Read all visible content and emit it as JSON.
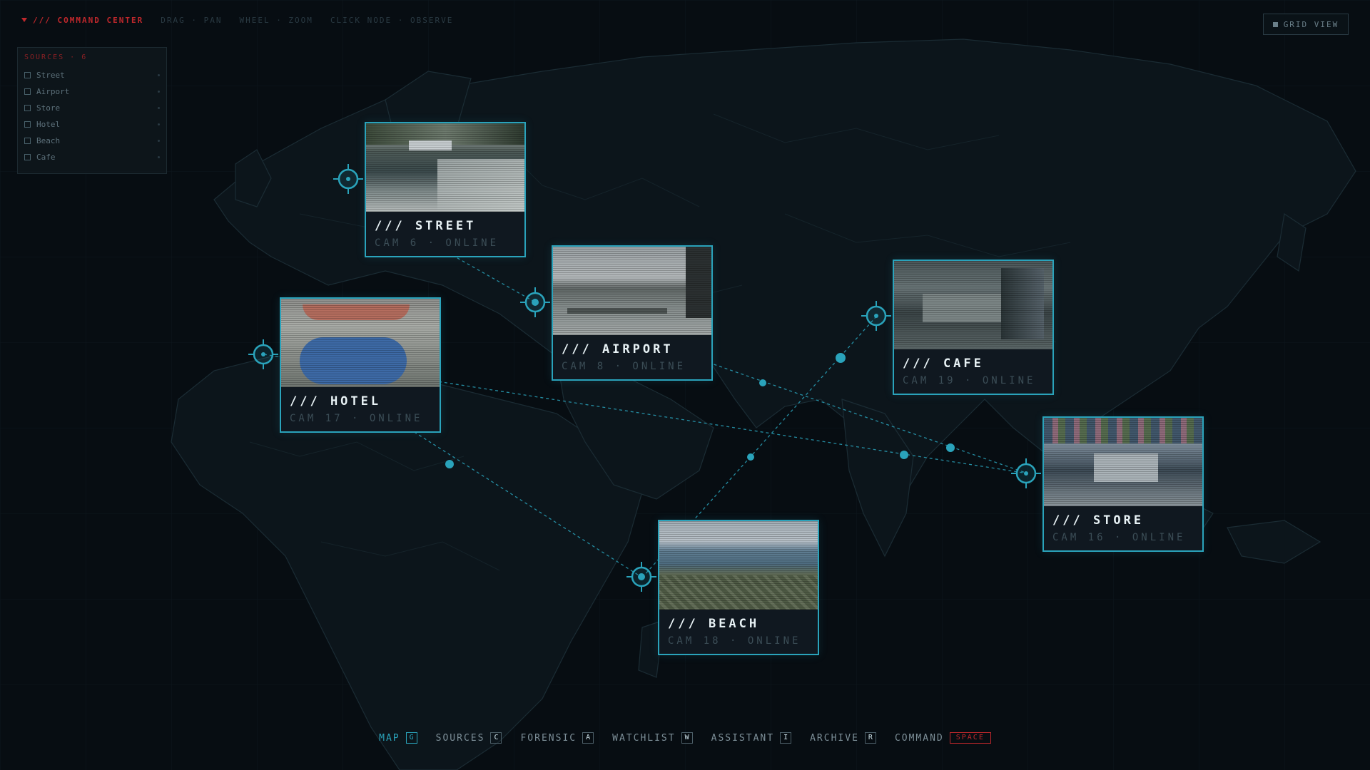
{
  "header": {
    "brand": "/// COMMAND CENTER",
    "hints": [
      "DRAG · PAN",
      "WHEEL · ZOOM",
      "CLICK NODE · OBSERVE"
    ],
    "grid_view_label": "GRID VIEW",
    "brand_color": "#c0282c"
  },
  "sources": {
    "title": "SOURCES · 6",
    "items": [
      "Street",
      "Airport",
      "Store",
      "Hotel",
      "Beach",
      "Cafe"
    ]
  },
  "cameras": [
    {
      "title": "/// STREET",
      "sub": "CAM 6 · ONLINE"
    },
    {
      "title": "/// AIRPORT",
      "sub": "CAM 8 · ONLINE"
    },
    {
      "title": "/// CAFE",
      "sub": "CAM 19 · ONLINE"
    },
    {
      "title": "/// HOTEL",
      "sub": "CAM 17 · ONLINE"
    },
    {
      "title": "/// STORE",
      "sub": "CAM 16 · ONLINE"
    },
    {
      "title": "/// BEACH",
      "sub": "CAM 18 · ONLINE"
    }
  ],
  "dock": [
    {
      "label": "MAP",
      "key": "G",
      "active": true
    },
    {
      "label": "SOURCES",
      "key": "C"
    },
    {
      "label": "FORENSIC",
      "key": "A"
    },
    {
      "label": "WATCHLIST",
      "key": "W"
    },
    {
      "label": "ASSISTANT",
      "key": "I"
    },
    {
      "label": "ARCHIVE",
      "key": "R"
    },
    {
      "label": "COMMAND",
      "key": "SPACE"
    }
  ],
  "accent_color": "#2aa3bb",
  "icons": [
    "triangle-icon",
    "grid-icon",
    "crosshair-icon"
  ]
}
